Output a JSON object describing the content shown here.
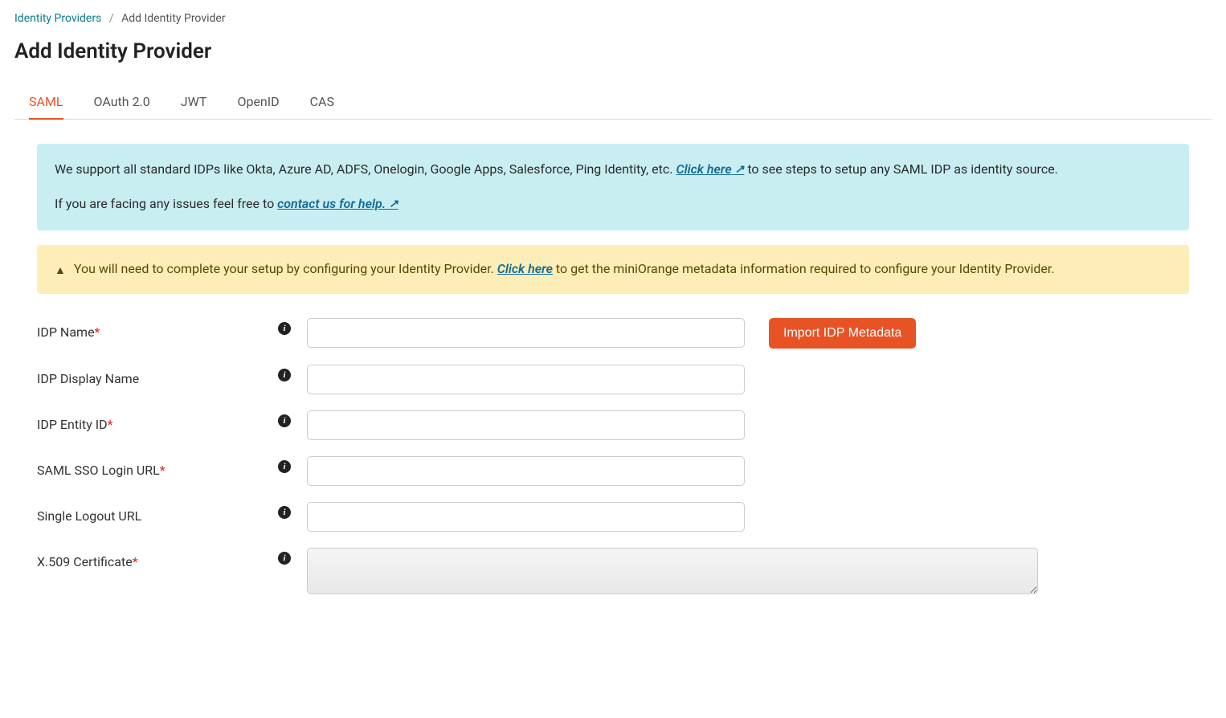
{
  "breadcrumb": {
    "parent": "Identity Providers",
    "current": "Add Identity Provider"
  },
  "page_title": "Add Identity Provider",
  "tabs": [
    {
      "label": "SAML",
      "active": true
    },
    {
      "label": "OAuth 2.0",
      "active": false
    },
    {
      "label": "JWT",
      "active": false
    },
    {
      "label": "OpenID",
      "active": false
    },
    {
      "label": "CAS",
      "active": false
    }
  ],
  "info_box": {
    "text_before_link": "We support all standard IDPs like Okta, Azure AD, ADFS, Onelogin, Google Apps, Salesforce, Ping Identity, etc. ",
    "link1": "Click here",
    "text_after_link": " to see steps to setup any SAML IDP as identity source.",
    "text2_before": "If you are facing any issues feel free to ",
    "link2": "contact us for help."
  },
  "warn_box": {
    "text_before": "You will need to complete your setup by configuring your Identity Provider. ",
    "link": "Click here",
    "text_after": " to get the miniOrange metadata information required to configure your Identity Provider."
  },
  "form": {
    "idp_name": {
      "label": "IDP Name",
      "required": true,
      "value": ""
    },
    "idp_display_name": {
      "label": "IDP Display Name",
      "required": false,
      "value": ""
    },
    "idp_entity_id": {
      "label": "IDP Entity ID",
      "required": true,
      "value": ""
    },
    "saml_sso_login_url": {
      "label": "SAML SSO Login URL",
      "required": true,
      "value": ""
    },
    "single_logout_url": {
      "label": "Single Logout URL",
      "required": false,
      "value": ""
    },
    "x509_cert": {
      "label": "X.509 Certificate",
      "required": true,
      "value": ""
    }
  },
  "buttons": {
    "import_metadata": "Import IDP Metadata"
  }
}
